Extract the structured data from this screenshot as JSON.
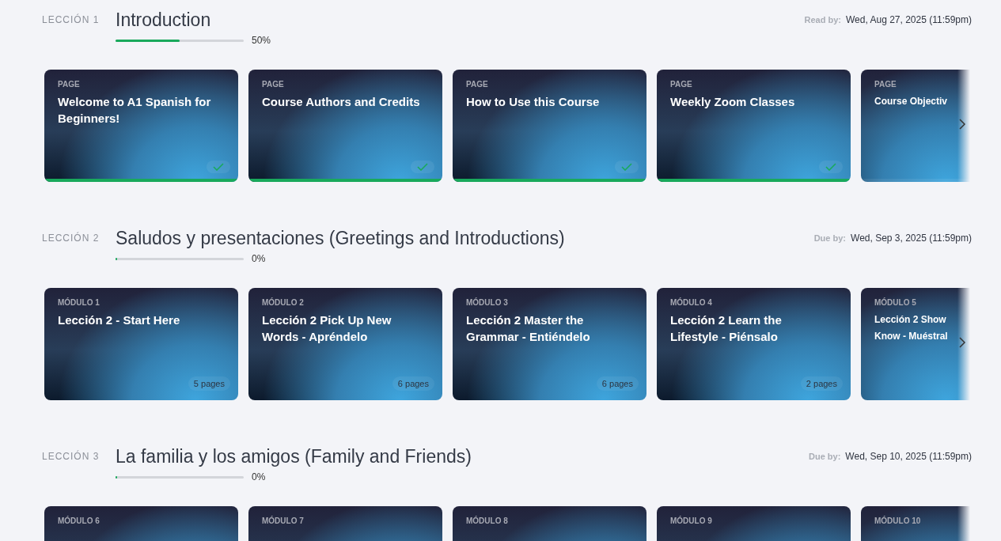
{
  "lessons": [
    {
      "label": "LECCIÓN 1",
      "title": "Introduction",
      "level": 0.5,
      "progress": "50%",
      "due_label": "Read by:",
      "due": "Wed, Aug 27, 2025 (11:59pm)",
      "cards": [
        {
          "kind": "page",
          "label": "PAGE",
          "title": "Welcome to A1 Spanish for Beginners!",
          "completed": true
        },
        {
          "kind": "page",
          "label": "PAGE",
          "title": "Course Authors and Credits",
          "completed": true
        },
        {
          "kind": "page",
          "label": "PAGE",
          "title": "How to Use this Course",
          "completed": true
        },
        {
          "kind": "page",
          "label": "PAGE",
          "title": "Weekly Zoom Classes",
          "completed": true
        },
        {
          "kind": "page",
          "label": "PAGE",
          "title": "Course Objectiv",
          "completed": false,
          "cut": true
        }
      ]
    },
    {
      "label": "LECCIÓN 2",
      "title": "Saludos y presentaciones (Greetings and Introductions)",
      "level": 0,
      "progress": "0%",
      "due_label": "Due by:",
      "due": "Wed, Sep 3, 2025 (11:59pm)",
      "cards": [
        {
          "kind": "module",
          "label": "MÓDULO 1",
          "title": "Lección 2 - Start Here",
          "pages": "5 pages"
        },
        {
          "kind": "module",
          "label": "MÓDULO 2",
          "title": "Lección 2 Pick Up New Words - Apréndelo",
          "pages": "6 pages"
        },
        {
          "kind": "module",
          "label": "MÓDULO 3",
          "title": "Lección 2 Master the Grammar - Entiéndelo",
          "pages": "6 pages"
        },
        {
          "kind": "module",
          "label": "MÓDULO 4",
          "title": "Lección 2 Learn the Lifestyle - Piénsalo",
          "pages": "2 pages"
        },
        {
          "kind": "module",
          "label": "MÓDULO 5",
          "title": "Lección 2 Show\nKnow - Muéstral",
          "cut": true
        }
      ]
    },
    {
      "label": "LECCIÓN 3",
      "title": "La familia y los amigos (Family and Friends)",
      "level": 0,
      "progress": "0%",
      "due_label": "Due by:",
      "due": "Wed, Sep 10, 2025 (11:59pm)",
      "cards": [
        {
          "kind": "module",
          "label": "MÓDULO 6"
        },
        {
          "kind": "module",
          "label": "MÓDULO 7"
        },
        {
          "kind": "module",
          "label": "MÓDULO 8"
        },
        {
          "kind": "module",
          "label": "MÓDULO 9"
        },
        {
          "kind": "module",
          "label": "MÓDULO 10",
          "cut": true
        }
      ]
    }
  ]
}
